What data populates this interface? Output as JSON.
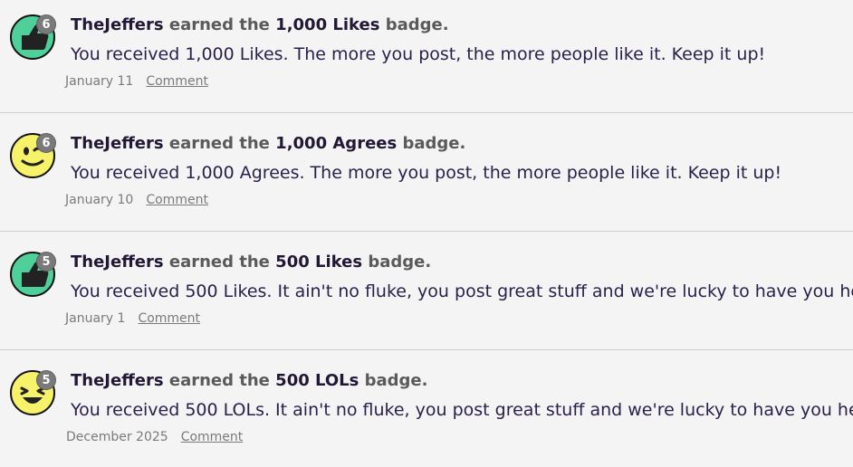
{
  "items": [
    {
      "user": "TheJeffers",
      "earned_text": " earned the ",
      "badge_name": "1,000 Likes",
      "badge_suffix": " badge.",
      "message": "You received 1,000 Likes. The more you post, the more people like it. Keep it up!",
      "date": "January 11",
      "comment_label": "Comment",
      "icon": "thumbs-up-icon",
      "count": "6"
    },
    {
      "user": "TheJeffers",
      "earned_text": " earned the ",
      "badge_name": "1,000 Agrees",
      "badge_suffix": " badge.",
      "message": "You received 1,000 Agrees. The more you post, the more people like it. Keep it up!",
      "date": "January 10",
      "comment_label": "Comment",
      "icon": "agree-smiley-icon",
      "count": "6"
    },
    {
      "user": "TheJeffers",
      "earned_text": " earned the ",
      "badge_name": "500 Likes",
      "badge_suffix": " badge.",
      "message": "You received 500 Likes. It ain't no fluke, you post great stuff and we're lucky to have you here.",
      "date": "January 1",
      "comment_label": "Comment",
      "icon": "thumbs-up-icon",
      "count": "5"
    },
    {
      "user": "TheJeffers",
      "earned_text": " earned the ",
      "badge_name": "500 LOLs",
      "badge_suffix": " badge.",
      "message": "You received 500 LOLs. It ain't no fluke, you post great stuff and we're lucky to have you here.",
      "date": "December 2025",
      "comment_label": "Comment",
      "icon": "lol-smiley-icon",
      "count": "5"
    }
  ],
  "colors": {
    "background": "#f4f4f4",
    "username": "#221836",
    "message": "#2a1f4a",
    "meta": "#7a7a7a",
    "like_green": "#4fcf9a",
    "smiley_yellow": "#f6f26a"
  }
}
